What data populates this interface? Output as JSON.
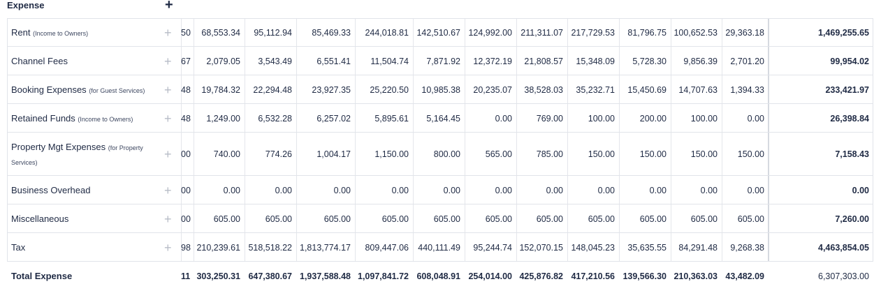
{
  "section": {
    "title": "Expense",
    "add_icon": "plus-icon"
  },
  "columns_clipped_prefix": true,
  "rows": [
    {
      "label": "Rent",
      "note": "(Income to Owners)",
      "clip": "50",
      "values": [
        "68,553.34",
        "95,112.94",
        "85,469.33",
        "244,018.81",
        "142,510.67",
        "124,992.00",
        "211,311.07",
        "217,729.53",
        "81,796.75",
        "100,652.53",
        "29,363.18"
      ],
      "total": "1,469,255.65"
    },
    {
      "label": "Channel Fees",
      "note": "",
      "clip": "67",
      "values": [
        "2,079.05",
        "3,543.49",
        "6,551.41",
        "11,504.74",
        "7,871.92",
        "12,372.19",
        "21,808.57",
        "15,348.09",
        "5,728.30",
        "9,856.39",
        "2,701.20"
      ],
      "total": "99,954.02"
    },
    {
      "label": "Booking Expenses",
      "note": "(for Guest Services)",
      "clip": "48",
      "values": [
        "19,784.32",
        "22,294.48",
        "23,927.35",
        "25,220.50",
        "10,985.38",
        "20,235.07",
        "38,528.03",
        "35,232.71",
        "15,450.69",
        "14,707.63",
        "1,394.33"
      ],
      "total": "233,421.97"
    },
    {
      "label": "Retained Funds",
      "note": "(Income to Owners)",
      "clip": "48",
      "values": [
        "1,249.00",
        "6,532.28",
        "6,257.02",
        "5,895.61",
        "5,164.45",
        "0.00",
        "769.00",
        "100.00",
        "200.00",
        "100.00",
        "0.00"
      ],
      "total": "26,398.84"
    },
    {
      "label": "Property Mgt Expenses",
      "note": "(for Property Services)",
      "clip": "00",
      "values": [
        "740.00",
        "774.26",
        "1,004.17",
        "1,150.00",
        "800.00",
        "565.00",
        "785.00",
        "150.00",
        "150.00",
        "150.00",
        "150.00"
      ],
      "total": "7,158.43"
    },
    {
      "label": "Business Overhead",
      "note": "",
      "clip": "00",
      "values": [
        "0.00",
        "0.00",
        "0.00",
        "0.00",
        "0.00",
        "0.00",
        "0.00",
        "0.00",
        "0.00",
        "0.00",
        "0.00"
      ],
      "total": "0.00"
    },
    {
      "label": "Miscellaneous",
      "note": "",
      "clip": "00",
      "values": [
        "605.00",
        "605.00",
        "605.00",
        "605.00",
        "605.00",
        "605.00",
        "605.00",
        "605.00",
        "605.00",
        "605.00",
        "605.00"
      ],
      "total": "7,260.00"
    },
    {
      "label": "Tax",
      "note": "",
      "clip": "98",
      "values": [
        "210,239.61",
        "518,518.22",
        "1,813,774.17",
        "809,447.06",
        "440,111.49",
        "95,244.74",
        "152,070.15",
        "148,045.23",
        "35,635.55",
        "84,291.48",
        "9,268.38"
      ],
      "total": "4,463,854.05"
    }
  ],
  "total_row": {
    "label": "Total Expense",
    "clip": "11",
    "values": [
      "303,250.31",
      "647,380.67",
      "1,937,588.48",
      "1,097,841.72",
      "608,048.91",
      "254,014.00",
      "425,876.82",
      "417,210.56",
      "139,566.30",
      "210,363.03",
      "43,482.09"
    ],
    "total": "6,307,303.00"
  }
}
